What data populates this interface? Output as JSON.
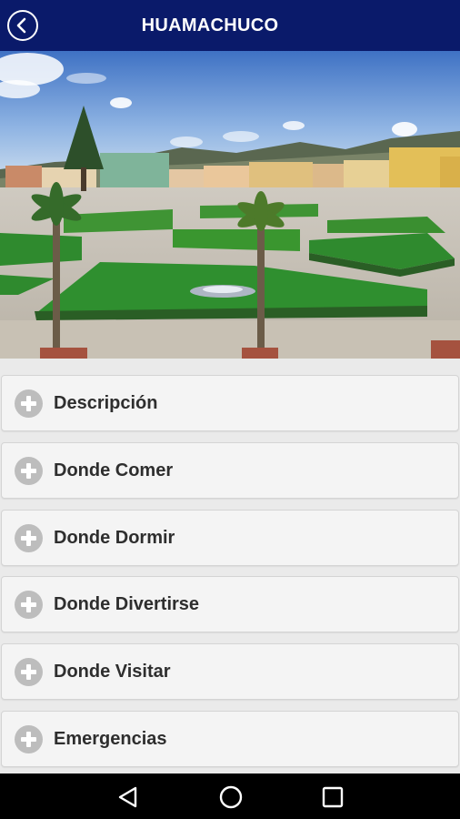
{
  "appbar": {
    "title": "HUAMACHUCO",
    "back_icon": "back-arrow-circle-icon",
    "background": "#0a1a6a"
  },
  "hero": {
    "subject": "town-plaza-photo"
  },
  "menu": {
    "items": [
      {
        "label": "Descripción",
        "icon": "plus-circle-icon"
      },
      {
        "label": "Donde Comer",
        "icon": "plus-circle-icon"
      },
      {
        "label": "Donde Dormir",
        "icon": "plus-circle-icon"
      },
      {
        "label": "Donde Divertirse",
        "icon": "plus-circle-icon"
      },
      {
        "label": "Donde Visitar",
        "icon": "plus-circle-icon"
      },
      {
        "label": "Emergencias",
        "icon": "plus-circle-icon"
      }
    ]
  },
  "navbar": {
    "buttons": [
      "back-triangle-icon",
      "home-circle-icon",
      "recents-square-icon"
    ]
  }
}
